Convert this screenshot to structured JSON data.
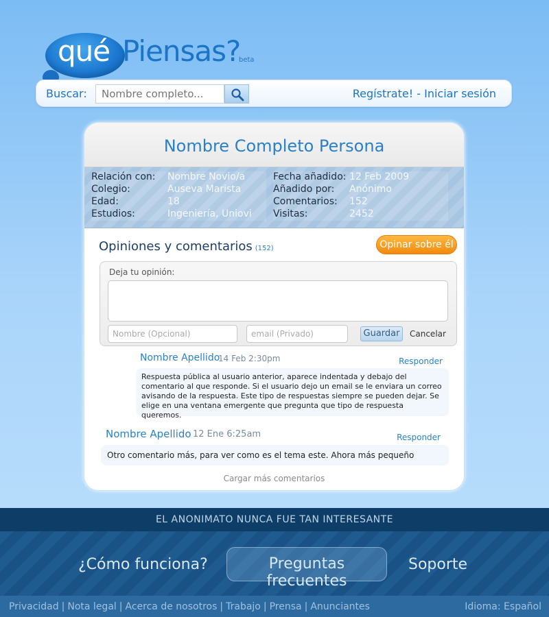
{
  "logo": {
    "que": "qué",
    "piensas": "Piensas?",
    "beta": "beta"
  },
  "search": {
    "label": "Buscar:",
    "placeholder": "Nombre completo..."
  },
  "auth": {
    "register": "Regístrate!",
    "separator": " - ",
    "login": "Iniciar sesión"
  },
  "profile": {
    "name": "Nombre Completo Persona",
    "left": [
      {
        "k": "Relación con:",
        "v": "Nombre Novio/a"
      },
      {
        "k": "Colegio:",
        "v": "Auseva Marista"
      },
      {
        "k": "Edad:",
        "v": "18"
      },
      {
        "k": "Estudios:",
        "v": "Ingeniería, Uniovi"
      }
    ],
    "right": [
      {
        "k": "Fecha añadido:",
        "v": "12 Feb 2009"
      },
      {
        "k": "Añadido por:",
        "v": "Anónimo"
      },
      {
        "k": "Comentarios:",
        "v": "152"
      },
      {
        "k": "Visitas:",
        "v": "2452"
      }
    ]
  },
  "comments": {
    "title": "Opiniones y comentarios",
    "count": "(152)",
    "opinar_label": "Opinar sobre él",
    "form": {
      "label": "Deja tu opinión:",
      "name_placeholder": "Nombre (Opcional)",
      "email_placeholder": "email (Privado)",
      "save": "Guardar",
      "cancel": "Cancelar"
    },
    "items": [
      {
        "author": "Nombre Apellido",
        "time": "14 Feb 2:30pm",
        "reply": "Responder",
        "body": "Respuesta pública al usuario anterior, aparece indentada y debajo del comentario al que responde. Si el usuario dejo un email se le enviara un correo avisando de la respuesta. Este tipo de respuestas siempre se pueden dejar. Se elige en una ventana emergente que pregunta que tipo de respuesta queremos."
      },
      {
        "author": "Nombre Apellido",
        "time": "12 Ene 6:25am",
        "reply": "Responder",
        "body": "Otro comentario más, para ver como es el tema este. Ahora más pequeño"
      }
    ],
    "load_more": "Cargar más comentarios"
  },
  "footer": {
    "tagline": "EL ANONIMATO NUNCA FUE TAN INTERESANTE",
    "nav": {
      "how": "¿Cómo funciona?",
      "faq": "Preguntas frecuentes",
      "support": "Soporte"
    },
    "links": [
      "Privacidad",
      "Nota legal",
      "Acerca de nosotros",
      "Trabajo",
      "Prensa",
      "Anunciantes"
    ],
    "language": "Idioma: Español"
  },
  "colors": {
    "accent": "#2a80c8",
    "orange": "#f28a0c",
    "footer_dark": "#0e3e67"
  }
}
